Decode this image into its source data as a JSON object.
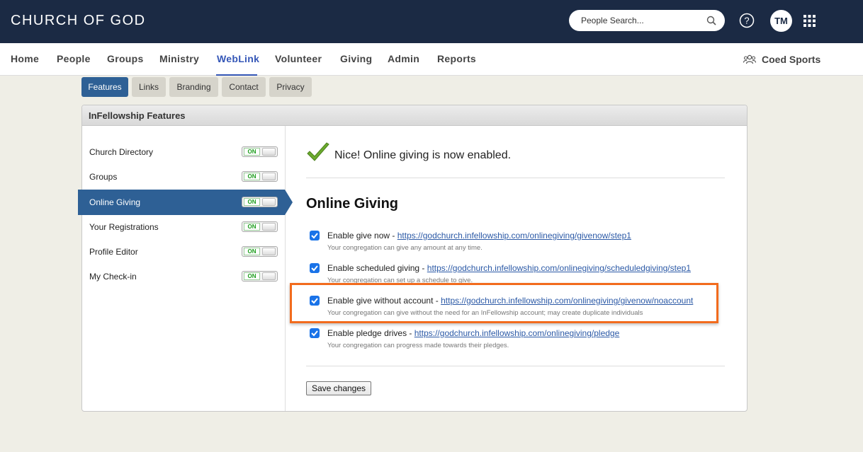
{
  "app": {
    "org_name": "CHURCH OF GOD"
  },
  "header": {
    "search_placeholder": "People Search...",
    "avatar_initials": "TM",
    "icons": [
      "search-icon",
      "help-icon",
      "apps-grid-icon"
    ]
  },
  "nav": {
    "items": [
      "Home",
      "People",
      "Groups",
      "Ministry",
      "WebLink",
      "Volunteer",
      "Giving",
      "Admin",
      "Reports"
    ],
    "active": "WebLink",
    "context_label": "Coed Sports",
    "accent_color": "#3557b7"
  },
  "subtabs": {
    "items": [
      "Features",
      "Links",
      "Branding",
      "Contact",
      "Privacy"
    ],
    "active": "Features"
  },
  "panel": {
    "title": "InFellowship Features",
    "features": [
      {
        "label": "Church Directory",
        "toggle": "ON"
      },
      {
        "label": "Groups",
        "toggle": "ON"
      },
      {
        "label": "Online Giving",
        "toggle": "ON"
      },
      {
        "label": "Your Registrations",
        "toggle": "ON"
      },
      {
        "label": "Profile Editor",
        "toggle": "ON"
      },
      {
        "label": "My Check-in",
        "toggle": "ON"
      }
    ],
    "active_feature": "Online Giving"
  },
  "content": {
    "success_message": "Nice! Online giving is now enabled.",
    "heading": "Online Giving",
    "options": [
      {
        "label": "Enable give now - ",
        "link": "https://godchurch.infellowship.com/onlinegiving/givenow/step1",
        "desc": "Your congregation can give any amount at any time.",
        "checked": true
      },
      {
        "label": "Enable scheduled giving - ",
        "link": "https://godchurch.infellowship.com/onlinegiving/scheduledgiving/step1",
        "desc": "Your congregation can set up a schedule to give.",
        "checked": true
      },
      {
        "label": "Enable give without account - ",
        "link": "https://godchurch.infellowship.com/onlinegiving/givenow/noaccount",
        "desc": "Your congregation can give without the need for an InFellowship account; may create duplicate individuals",
        "checked": true
      },
      {
        "label": "Enable pledge drives - ",
        "link": "https://godchurch.infellowship.com/onlinegiving/pledge",
        "desc": "Your congregation can progress made towards their pledges.",
        "checked": true
      }
    ],
    "save_label": "Save changes",
    "highlight_color": "#f26b1d"
  }
}
